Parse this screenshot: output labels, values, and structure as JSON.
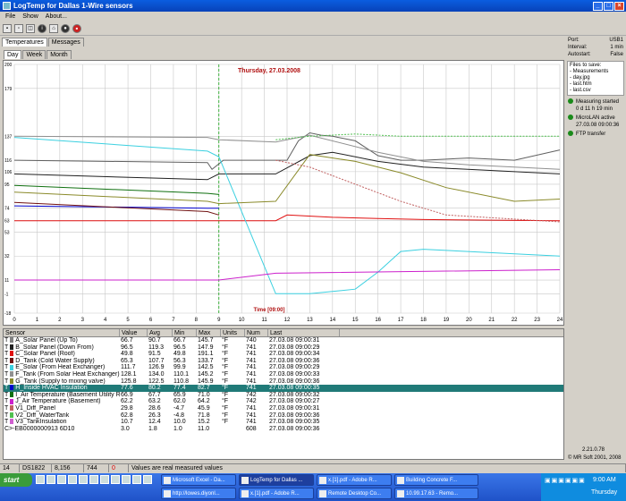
{
  "window": {
    "title": "LogTemp for Dallas 1-Wire sensors"
  },
  "menu": [
    "File",
    "Show",
    "About..."
  ],
  "tabs": [
    "Temperatures",
    "Messages"
  ],
  "subtabs": [
    "Day",
    "Week",
    "Month"
  ],
  "chart_data": {
    "type": "line",
    "title": "Thursday, 27.03.2008",
    "xlabel": "Time [09:00]",
    "x_ticks": [
      "0",
      "1",
      "2",
      "3",
      "4",
      "5",
      "6",
      "7",
      "8",
      "9",
      "10",
      "11",
      "12",
      "13",
      "14",
      "15",
      "16",
      "17",
      "18",
      "19",
      "20",
      "21",
      "22",
      "23",
      "24"
    ],
    "y_ticks": [
      "-18",
      "-1",
      "11",
      "32",
      "53",
      "63",
      "74",
      "95",
      "106",
      "116",
      "137",
      "179",
      "200"
    ],
    "ylim": [
      -18,
      200
    ],
    "xlim": [
      0,
      24
    ],
    "marker_x": 9,
    "series": [
      {
        "color": "#606060",
        "values": [
          [
            0,
            116
          ],
          [
            8.5,
            114
          ],
          [
            8.7,
            108
          ],
          [
            9.2,
            116
          ],
          [
            11.5,
            116
          ],
          [
            12,
            116
          ],
          [
            12.5,
            133
          ],
          [
            13,
            140
          ],
          [
            13.5,
            138
          ],
          [
            14,
            137
          ],
          [
            15,
            133
          ],
          [
            16,
            120
          ],
          [
            17,
            116
          ],
          [
            18,
            116
          ],
          [
            20,
            118
          ],
          [
            22,
            116
          ],
          [
            24,
            125
          ]
        ]
      },
      {
        "color": "#e01010",
        "values": [
          [
            0,
            63
          ],
          [
            8.5,
            63
          ],
          [
            9,
            63
          ],
          [
            11.5,
            63
          ],
          [
            12,
            68
          ],
          [
            14,
            66
          ],
          [
            16,
            65
          ],
          [
            18,
            64
          ],
          [
            24,
            63
          ]
        ]
      },
      {
        "color": "#202020",
        "values": [
          [
            0,
            104
          ],
          [
            8.5,
            99
          ],
          [
            9,
            104
          ],
          [
            11.5,
            104
          ],
          [
            13,
            120
          ],
          [
            14,
            123
          ],
          [
            16,
            115
          ],
          [
            18,
            110
          ],
          [
            24,
            104
          ]
        ]
      },
      {
        "color": "#3bd0e0",
        "values": [
          [
            0,
            136
          ],
          [
            8.5,
            124
          ],
          [
            9,
            119
          ],
          [
            11.5,
            -1
          ],
          [
            13,
            -1
          ],
          [
            15,
            3
          ],
          [
            16,
            18
          ],
          [
            17,
            36
          ],
          [
            18,
            38
          ],
          [
            24,
            32
          ]
        ]
      },
      {
        "color": "#909090",
        "values": [
          [
            0,
            137
          ],
          [
            8.5,
            136
          ],
          [
            9,
            134
          ],
          [
            11.5,
            132
          ],
          [
            13,
            138
          ],
          [
            16,
            123
          ],
          [
            18,
            115
          ],
          [
            20,
            112
          ],
          [
            24,
            108
          ]
        ]
      },
      {
        "color": "#8a8a2a",
        "values": [
          [
            0,
            88
          ],
          [
            8.5,
            80
          ],
          [
            9,
            78
          ],
          [
            11.5,
            80
          ],
          [
            13,
            121
          ],
          [
            15,
            115
          ],
          [
            17,
            105
          ],
          [
            19,
            92
          ],
          [
            22,
            80
          ],
          [
            24,
            82
          ]
        ]
      },
      {
        "color": "#0000cc",
        "values": [
          [
            0,
            76
          ],
          [
            8.5,
            74
          ],
          [
            9,
            74
          ]
        ]
      },
      {
        "color": "#107010",
        "values": [
          [
            0,
            94
          ],
          [
            8.5,
            87
          ],
          [
            9,
            86
          ]
        ]
      },
      {
        "color": "#cc20cc",
        "values": [
          [
            0,
            11
          ],
          [
            8.5,
            11
          ],
          [
            9,
            11
          ],
          [
            11.5,
            17
          ],
          [
            24,
            20
          ]
        ]
      },
      {
        "color": "#701010",
        "values": [
          [
            0,
            79
          ],
          [
            8.5,
            71
          ],
          [
            9,
            68
          ]
        ]
      },
      {
        "color": "#c06060",
        "values": [
          [
            11.5,
            116
          ],
          [
            13,
            110
          ],
          [
            15,
            95
          ],
          [
            17,
            80
          ],
          [
            19,
            68
          ],
          [
            24,
            62
          ]
        ]
      },
      {
        "color": "#50c050",
        "values": [
          [
            11.5,
            134
          ],
          [
            13,
            137
          ],
          [
            15,
            139
          ],
          [
            17,
            137
          ],
          [
            24,
            137
          ]
        ]
      }
    ]
  },
  "side": {
    "port_label": "Port:",
    "port_value": "USB1",
    "interval_label": "Interval:",
    "interval_value": "1 min",
    "autostart_label": "Autostart:",
    "autostart_value": "False",
    "files_title": "Files to save:",
    "files": [
      "- Measurements",
      "- day.jpg",
      "- last.htm",
      "- last.csv"
    ],
    "status": [
      {
        "line1": "Measuring started",
        "line2": "0 d 11 h 19 min"
      },
      {
        "line1": "MicroLAN active",
        "line2": "27.03.08 09:00:36"
      },
      {
        "line1": "FTP transfer",
        "line2": ""
      }
    ],
    "version": "2.21.0.78",
    "copyright": "© MR Soft 2001, 2008"
  },
  "table": {
    "headers": [
      "Sensor",
      "Value",
      "Avg",
      "Min",
      "Max",
      "Units",
      "Num",
      "Last"
    ],
    "rows": [
      {
        "label": "A_Solar Panel (Up To)",
        "color": "#808080",
        "v": [
          "66.7",
          "90.7",
          "66.7",
          "145.7",
          "°F",
          "740",
          "27.03.08 09:00:31"
        ]
      },
      {
        "label": "B_Solar Panel (Down From)",
        "color": "#202020",
        "v": [
          "96.5",
          "119.3",
          "96.5",
          "147.9",
          "°F",
          "741",
          "27.03.08 09:00:29"
        ]
      },
      {
        "label": "C_Solar Panel (Roof)",
        "color": "#e01010",
        "v": [
          "49.8",
          "91.5",
          "49.8",
          "191.1",
          "°F",
          "741",
          "27.03.08 09:00:34"
        ]
      },
      {
        "label": "D_Tank (Cold Water Supply)",
        "color": "#701010",
        "v": [
          "65.3",
          "107.7",
          "56.3",
          "133.7",
          "°F",
          "741",
          "27.03.08 09:00:36"
        ]
      },
      {
        "label": "E_Solar (From Heat Exchanger)",
        "color": "#3bd0e0",
        "v": [
          "111.7",
          "126.9",
          "99.9",
          "142.5",
          "°F",
          "741",
          "27.03.08 09:00:29"
        ]
      },
      {
        "label": "F_Tank (From Solar Heat Exchanger)",
        "color": "#909090",
        "v": [
          "128.1",
          "134.0",
          "110.1",
          "145.2",
          "°F",
          "741",
          "27.03.08 09:00:33"
        ]
      },
      {
        "label": "G_Tank (Supply to mixing valve)",
        "color": "#8a8a2a",
        "v": [
          "125.8",
          "122.5",
          "110.8",
          "145.9",
          "°F",
          "741",
          "27.03.08 09:00:36"
        ]
      },
      {
        "label": "H_Inside HVAC Insulation",
        "color": "#0000cc",
        "v": [
          "77.6",
          "80.2",
          "77.4",
          "82.7",
          "°F",
          "741",
          "27.03.08 09:00:35"
        ],
        "selected": true
      },
      {
        "label": "I_Air Temperature (Basement Utility Room)",
        "color": "#107010",
        "v": [
          "66.9",
          "67.7",
          "65.9",
          "71.0",
          "°F",
          "742",
          "27.03.08 09:00:32"
        ]
      },
      {
        "label": "J_Air Temperature (Basement)",
        "color": "#cc20cc",
        "v": [
          "62.2",
          "63.2",
          "62.0",
          "64.2",
          "°F",
          "742",
          "27.03.08 09:00:27"
        ]
      },
      {
        "label": "V1_Diff_Panel",
        "color": "#c06060",
        "v": [
          "29.8",
          "28.6",
          "-4.7",
          "45.9",
          "°F",
          "741",
          "27.03.08 09:00:31"
        ]
      },
      {
        "label": "V2_Diff_WaterTank",
        "color": "#50c050",
        "v": [
          "62.8",
          "26.3",
          "-4.8",
          "71.8",
          "°F",
          "741",
          "27.03.08 09:00:36"
        ]
      },
      {
        "label": "V3_TankInsulation",
        "color": "#d060d0",
        "v": [
          "10.7",
          "12.4",
          "10.0",
          "15.2",
          "°F",
          "741",
          "27.03.08 09:00:35"
        ]
      },
      {
        "label": "C>-EB0000000913 6D10",
        "color": "",
        "v": [
          "3.0",
          "1.8",
          "1.0",
          "11.0",
          "",
          "608",
          "27.03.08 09:00:36"
        ]
      }
    ]
  },
  "statusbar": [
    "14",
    "DS1822",
    "8,156",
    "744",
    "0",
    "Values are real measured values"
  ],
  "taskbar": {
    "start": "start",
    "buttons": [
      "Microsoft Excel - Da...",
      "LogTemp for Dallas ...",
      "x.[1].pdf - Adobe R...",
      "Building Concrete F...",
      "http://lowes.diyonl...",
      "x.[1].pdf - Adobe R...",
      "Remote Desktop Co...",
      "10.99.17.63 - Remo..."
    ],
    "time": "9:00 AM",
    "day": "Thursday"
  }
}
